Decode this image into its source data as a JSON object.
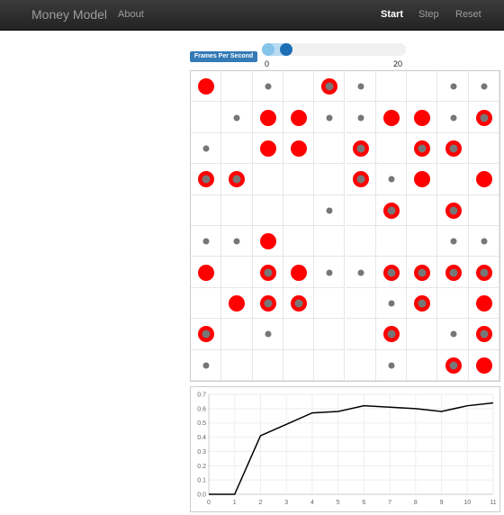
{
  "navbar": {
    "brand": "Money Model",
    "about": "About",
    "start": "Start",
    "step": "Step",
    "reset": "Reset"
  },
  "controls": {
    "fps_label": "Frames Per Second",
    "fps_min": "0",
    "fps_max": "20",
    "fps_range": [
      0,
      20
    ],
    "fps_selected": [
      0,
      1
    ]
  },
  "grid": {
    "rows": 10,
    "cols": 10,
    "cells": [
      [
        "B",
        "",
        "G",
        "",
        "Y",
        "G",
        "",
        "",
        "G",
        "G"
      ],
      [
        "",
        "G",
        "B",
        "B",
        "G",
        "G",
        "B",
        "B",
        "G",
        "Y"
      ],
      [
        "G",
        "",
        "B",
        "B",
        "",
        "Y",
        "",
        "Y",
        "Y",
        ""
      ],
      [
        "Y",
        "Y",
        "",
        "",
        "",
        "Y",
        "G",
        "B",
        "",
        "B"
      ],
      [
        "",
        "",
        "",
        "",
        "G",
        "",
        "Y",
        "",
        "Y",
        ""
      ],
      [
        "G",
        "G",
        "B",
        "",
        "",
        "",
        "",
        "",
        "G",
        "G"
      ],
      [
        "B",
        "",
        "Y",
        "B",
        "G",
        "G",
        "Y",
        "Y",
        "Y",
        "Y"
      ],
      [
        "",
        "B",
        "Y",
        "Y",
        "",
        "",
        "G",
        "Y",
        "",
        "B"
      ],
      [
        "Y",
        "",
        "G",
        "",
        "",
        "",
        "Y",
        "",
        "G",
        "Y"
      ],
      [
        "G",
        "",
        "",
        "",
        "",
        "",
        "G",
        "",
        "Y",
        "B"
      ]
    ],
    "legend": {
      "B": "agent with wealth, no gray",
      "G": "gray agent",
      "Y": "red agent with gray center"
    },
    "colors": {
      "red": "#ff0000",
      "gray": "#777777",
      "gridline": "#e6e6e6"
    }
  },
  "chart_data": {
    "type": "line",
    "x": [
      0,
      1,
      2,
      3,
      4,
      5,
      6,
      7,
      8,
      9,
      10,
      11
    ],
    "series": [
      {
        "values": [
          0.0,
          0.0,
          0.41,
          0.49,
          0.57,
          0.58,
          0.62,
          0.61,
          0.6,
          0.58,
          0.62,
          0.64
        ],
        "color": "#000000"
      }
    ],
    "xlim": [
      0,
      11
    ],
    "ylim": [
      0.0,
      0.7
    ],
    "yticks": [
      0.0,
      0.1,
      0.2,
      0.3,
      0.4,
      0.5,
      0.6,
      0.7
    ],
    "xticks": [
      0,
      1,
      2,
      3,
      4,
      5,
      6,
      7,
      8,
      9,
      10,
      11
    ],
    "grid": true
  }
}
